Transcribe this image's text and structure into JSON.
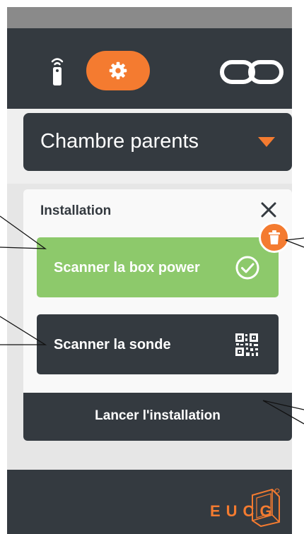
{
  "header": {
    "remote_icon": "remote-control-icon",
    "settings_icon": "gear-icon",
    "loop_icon": "infinity-loop-icon",
    "accent_color": "#f47b30",
    "bar_color": "#343a40"
  },
  "room_selector": {
    "selected": "Chambre parents",
    "icon": "chevron-down-icon"
  },
  "installation": {
    "title": "Installation",
    "close_icon": "close-icon",
    "delete_icon": "trash-icon",
    "scan_power_label": "Scanner la box power",
    "scan_power_status_icon": "check-circle-icon",
    "scan_power_color": "#8dc96b",
    "scan_sonde_label": "Scanner la sonde",
    "scan_sonde_icon": "qr-code-icon",
    "launch_label": "Lancer l'installation"
  },
  "footer": {
    "logo_text": "EUCG"
  }
}
